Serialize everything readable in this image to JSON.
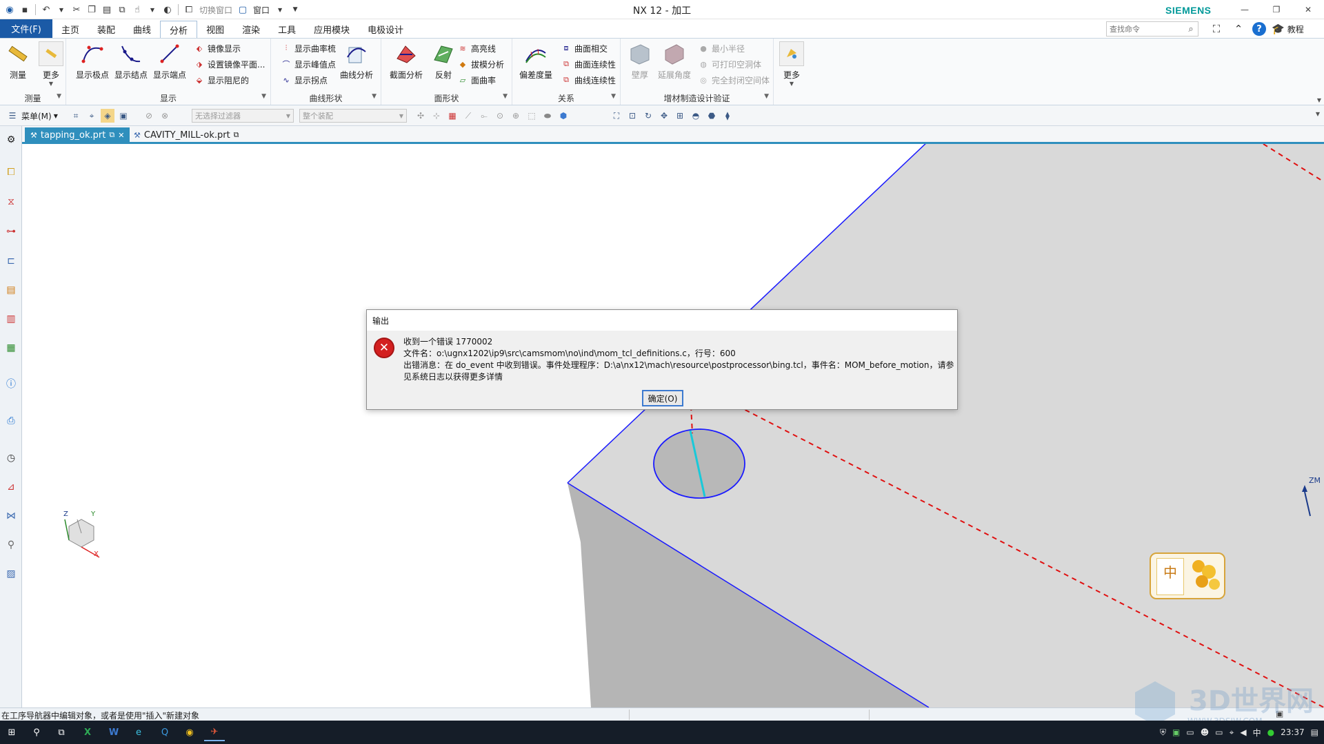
{
  "window": {
    "title": "NX 12 - 加工",
    "brand": "SIEMENS",
    "qat_switch_window": "切换窗口",
    "qat_window": "窗口"
  },
  "tabs": [
    "主页",
    "装配",
    "曲线",
    "分析",
    "视图",
    "渲染",
    "工具",
    "应用模块",
    "电极设计"
  ],
  "file_tab": "文件(F)",
  "search_placeholder": "查找命令",
  "tutorial": "教程",
  "ribbon": {
    "measure_group": {
      "title": "测量",
      "measure": "测量",
      "more": "更多"
    },
    "display_group": {
      "title": "显示",
      "show_poles": "显示极点",
      "show_knots": "显示结点",
      "show_endpoints": "显示端点",
      "mirror_display": "镜像显示",
      "set_mirror_plane": "设置镜像平面...",
      "show_damping": "显示阻尼的"
    },
    "curve_shape_group": {
      "title": "曲线形状",
      "show_curvature_comb": "显示曲率梳",
      "show_peaks": "显示峰值点",
      "show_inflections": "显示拐点",
      "curve_analysis": "曲线分析"
    },
    "face_shape_group": {
      "title": "面形状",
      "section_analysis": "截面分析",
      "reflection": "反射",
      "highlight_lines": "高亮线",
      "draft_analysis": "拔模分析",
      "face_curvature": "面曲率"
    },
    "relation_group": {
      "title": "关系",
      "deviation": "偏差度量",
      "surface_intersection": "曲面相交",
      "surface_continuity": "曲面连续性",
      "curve_continuity": "曲线连续性"
    },
    "additive_group": {
      "title": "增材制造设计验证",
      "wall_thickness": "壁厚",
      "overhang_angle": "延展角度",
      "min_radius": "最小半径",
      "printable_cavity": "可打印空洞体",
      "closed_cavity": "完全封闭空间体"
    },
    "more": "更多"
  },
  "toolbar2": {
    "menu": "菜单(M)",
    "filter": "无选择过滤器",
    "assembly": "整个装配"
  },
  "doc_tabs": [
    {
      "label": "tapping_ok.prt",
      "active": true
    },
    {
      "label": "CAVITY_MILL-ok.prt",
      "active": false
    }
  ],
  "dialog": {
    "title": "输出",
    "line1": "收到一个错误 1770002",
    "line2": "文件名：o:\\ugnx1202\\ip9\\src\\camsmom\\no\\ind\\mom_tcl_definitions.c，行号：600",
    "line3": "出错消息：在 do_event 中收到错误。事件处理程序：D:\\a\\nx12\\mach\\resource\\postprocessor\\bing.tcl，事件名：MOM_before_motion，请参",
    "line4": "见系统日志以获得更多详情",
    "ok": "确定(O)"
  },
  "viewport": {
    "zm_label": "ZM",
    "triad": {
      "x": "X",
      "y": "Y",
      "z": "Z"
    }
  },
  "ime": {
    "char": "中"
  },
  "status": "在工序导航器中编辑对象，或者是使用\"插入\"新建对象",
  "watermark": {
    "main": "3D世界网",
    "sub": "WWW.3DSJW.COM"
  },
  "taskbar": {
    "tray_ime": "中",
    "clock": "23:37"
  },
  "colors": {
    "file_tab": "#1b5aa6",
    "doc_tab_active": "#2f8fbd",
    "error_red": "#d32020",
    "model_edge": "#1a1aff",
    "toolpath": "#e01010",
    "model_face": "#d9d9d9"
  }
}
